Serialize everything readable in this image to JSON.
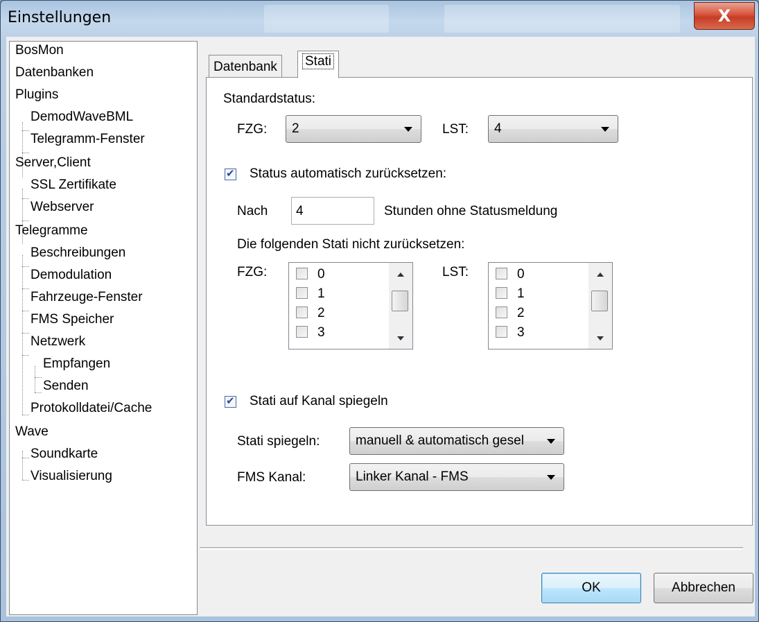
{
  "window": {
    "title": "Einstellungen",
    "close_glyph": "X"
  },
  "tree": [
    {
      "label": "BosMon",
      "level": 0
    },
    {
      "label": "Datenbanken",
      "level": 0
    },
    {
      "label": "Plugins",
      "level": 0
    },
    {
      "label": "DemodWaveBML",
      "level": 1
    },
    {
      "label": "Telegramm-Fenster",
      "level": 1
    },
    {
      "label": "Server,Client",
      "level": 0
    },
    {
      "label": "SSL Zertifikate",
      "level": 1
    },
    {
      "label": "Webserver",
      "level": 1
    },
    {
      "label": "Telegramme",
      "level": 0
    },
    {
      "label": "Beschreibungen",
      "level": 1
    },
    {
      "label": "Demodulation",
      "level": 1
    },
    {
      "label": "Fahrzeuge-Fenster",
      "level": 1
    },
    {
      "label": "FMS Speicher",
      "level": 1
    },
    {
      "label": "Netzwerk",
      "level": 1
    },
    {
      "label": "Empfangen",
      "level": 2
    },
    {
      "label": "Senden",
      "level": 2
    },
    {
      "label": "Protokolldatei/Cache",
      "level": 1
    },
    {
      "label": "Wave",
      "level": 0
    },
    {
      "label": "Soundkarte",
      "level": 1
    },
    {
      "label": "Visualisierung",
      "level": 1
    }
  ],
  "tabs": {
    "datenbank": "Datenbank",
    "stati": "Stati"
  },
  "standard": {
    "heading": "Standardstatus:",
    "fzg_label": "FZG:",
    "fzg_value": "2",
    "lst_label": "LST:",
    "lst_value": "4"
  },
  "reset": {
    "checkbox_label": "Status automatisch zurücksetzen:",
    "checked": true,
    "nach_label": "Nach",
    "hours_value": "4",
    "hours_suffix": "Stunden ohne Statusmeldung",
    "exclude_heading": "Die folgenden Stati nicht zurücksetzen:",
    "fzg_label": "FZG:",
    "lst_label": "LST:",
    "fzg_items": [
      "0",
      "1",
      "2",
      "3"
    ],
    "lst_items": [
      "0",
      "1",
      "2",
      "3"
    ]
  },
  "mirror": {
    "checkbox_label": "Stati auf Kanal spiegeln",
    "checked": true,
    "mode_label": "Stati spiegeln:",
    "mode_value": "manuell & automatisch gesel",
    "channel_label": "FMS Kanal:",
    "channel_value": "Linker Kanal - FMS"
  },
  "buttons": {
    "ok": "OK",
    "cancel": "Abbrechen"
  }
}
